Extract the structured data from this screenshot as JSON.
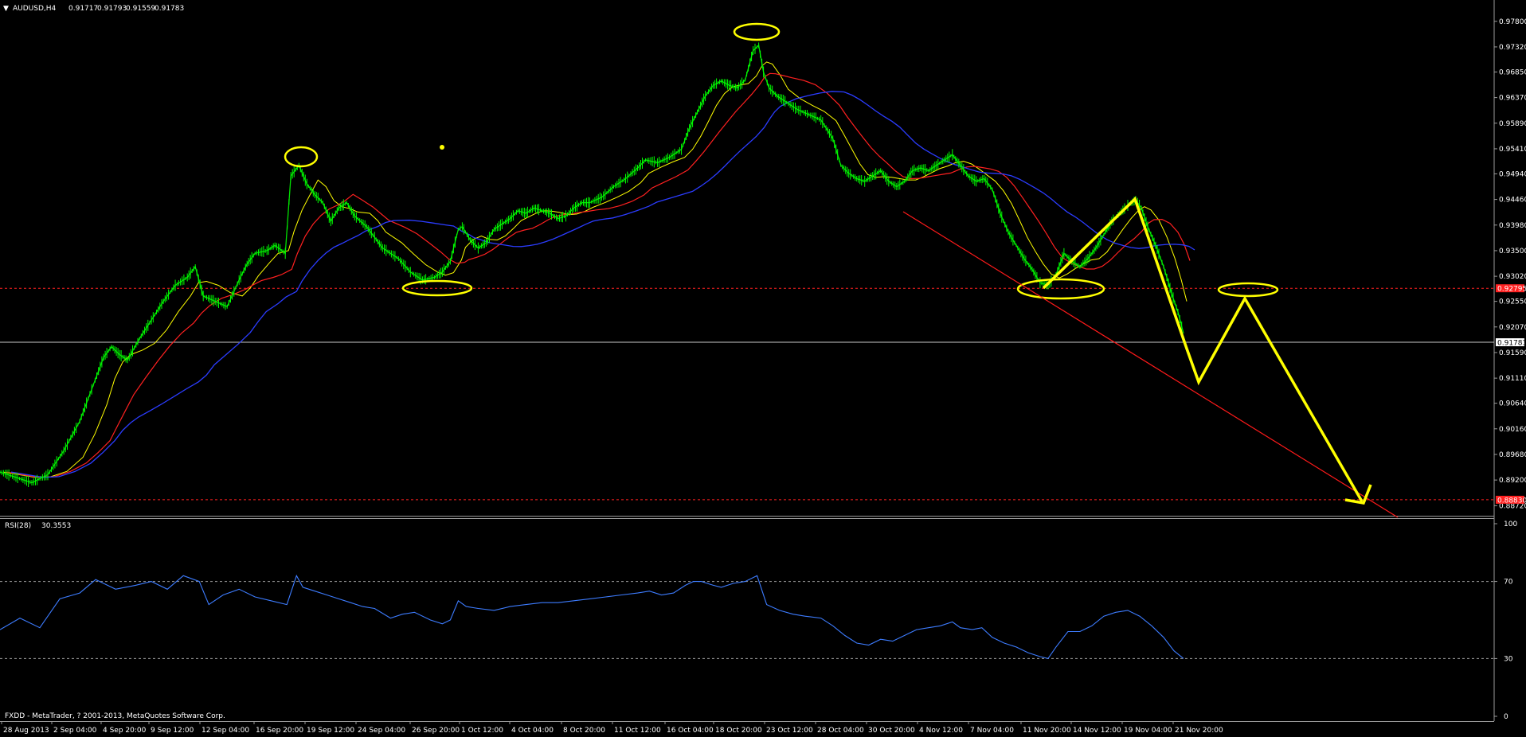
{
  "chart_data": [
    {
      "type": "line",
      "instrument_label": "AUDUSD,H4",
      "ohlc_readout": [
        "0.91717",
        "0.91793",
        "0.91559",
        "0.91783"
      ],
      "x_ticks": [
        "28 Aug 2013",
        "2 Sep 04:00",
        "4 Sep 20:00",
        "9 Sep 12:00",
        "12 Sep 04:00",
        "16 Sep 20:00",
        "19 Sep 12:00",
        "24 Sep 04:00",
        "26 Sep 20:00",
        "1 Oct 12:00",
        "4 Oct 04:00",
        "8 Oct 20:00",
        "11 Oct 12:00",
        "16 Oct 04:00",
        "18 Oct 20:00",
        "23 Oct 12:00",
        "28 Oct 04:00",
        "30 Oct 20:00",
        "4 Nov 12:00",
        "7 Nov 04:00",
        "11 Nov 20:00",
        "14 Nov 12:00",
        "19 Nov 04:00",
        "21 Nov 20:00"
      ],
      "y_ticks": [
        "0.97800",
        "0.97320",
        "0.96850",
        "0.96370",
        "0.95890",
        "0.95410",
        "0.94940",
        "0.94460",
        "0.93980",
        "0.93500",
        "0.93020",
        "0.92550",
        "0.92070",
        "0.91590",
        "0.91110",
        "0.90640",
        "0.90160",
        "0.89680",
        "0.89200",
        "0.88720"
      ],
      "ylim": [
        0.8862,
        0.9808
      ],
      "price_tags": [
        {
          "text": "0.92795",
          "value": 0.92795,
          "color": "#ff2020"
        },
        {
          "text": "0.91783",
          "value": 0.91783,
          "color": "#ffffff"
        },
        {
          "text": "0.88830",
          "value": 0.8883,
          "color": "#ff2020"
        }
      ],
      "series": [
        {
          "role": "price",
          "color": "#00ff00",
          "x": [
            0,
            6,
            11,
            14,
            20,
            25,
            28,
            30,
            33,
            35,
            38,
            40,
            43,
            46,
            49,
            52,
            54,
            57,
            61,
            65,
            68,
            73,
            78,
            81,
            84,
            86,
            88,
            90,
            93,
            95,
            98,
            101,
            103,
            104,
            106,
            109,
            110,
            111,
            113,
            114,
            116,
            117,
            118,
            119,
            120,
            122,
            123,
            124,
            126,
            128,
            131,
            133,
            135,
            137,
            139,
            141,
            143,
            144,
            147,
            149,
            153,
            156,
            158,
            160,
            162,
            164,
            165,
            167,
            170,
            175,
            179,
            183,
            187,
            189,
            191,
            193,
            195,
            198,
            201,
            203,
            205,
            208,
            210,
            213,
            215,
            218,
            219,
            221,
            223,
            226,
            227,
            228,
            229,
            231,
            232,
            232.5,
            233,
            236,
            240,
            243,
            246,
            248,
            250,
            252,
            255,
            257,
            260,
            263,
            266,
            268,
            271,
            273,
            275,
            277,
            279,
            281,
            283,
            285,
            287
          ],
          "y": [
            0.893,
            0.8922,
            0.8916,
            0.8912,
            0.8922,
            0.8935,
            0.8948,
            0.8965,
            0.8982,
            0.8997,
            0.9012,
            0.9025,
            0.9035,
            0.9048,
            0.9058,
            0.9068,
            0.9082,
            0.9096,
            0.9113,
            0.913,
            0.9146,
            0.9158,
            0.9168,
            0.9175,
            0.9166,
            0.9156,
            0.9161,
            0.9172,
            0.9188,
            0.9205,
            0.9218,
            0.923,
            0.9242,
            0.9254,
            0.9265,
            0.9277,
            0.9289,
            0.93,
            0.9312,
            0.9322,
            0.9303,
            0.9285,
            0.9275,
            0.927,
            0.9265,
            0.9259,
            0.9252,
            0.9247,
            0.9243,
            0.9258,
            0.929,
            0.932,
            0.9329,
            0.9321,
            0.9318,
            0.9327,
            0.9336,
            0.9343,
            0.9355,
            0.9359,
            0.937,
            0.944,
            0.9482,
            0.951,
            0.9521,
            0.9515,
            0.9497,
            0.9482,
            0.9468,
            0.9458,
            0.9451,
            0.9439,
            0.9425,
            0.9405,
            0.9415,
            0.9433,
            0.9442,
            0.9428,
            0.9418,
            0.9405,
            0.9392,
            0.938,
            0.9365,
            0.935,
            0.9347,
            0.9332,
            0.9318,
            0.9305,
            0.9295,
            0.9284,
            0.9287,
            0.9298,
            0.931,
            0.932,
            0.933,
            0.9337,
            0.9345,
            0.9353,
            0.9357,
            0.9368,
            0.9384,
            0.9398,
            0.9407,
            0.9415,
            0.942,
            0.943,
            0.9445,
            0.9458,
            0.9468,
            0.9479,
            0.9484,
            0.9487,
            0.9481,
            0.9472,
            0.9461,
            0.9449,
            0.9431,
            0.942,
            0.9412
          ]
        },
        {
          "role": "price-continued",
          "color": "#00ff00",
          "x": [
            287,
            290,
            293,
            296,
            300,
            302,
            304,
            306,
            308,
            310,
            313,
            316,
            319,
            322,
            324,
            326,
            328,
            330,
            332,
            334,
            336,
            338,
            340,
            343,
            345,
            347,
            349,
            351,
            352,
            353,
            354,
            356,
            358,
            360,
            362,
            364,
            366,
            368,
            370,
            372,
            373,
            375,
            377,
            379,
            381,
            383,
            385,
            386,
            388,
            390,
            391,
            392,
            393,
            394,
            396,
            398,
            400,
            402,
            404,
            406,
            408,
            410,
            412,
            414,
            416,
            418,
            420,
            422,
            425,
            428,
            431,
            434,
            437,
            440,
            443,
            446,
            449,
            452,
            455,
            458,
            461,
            464,
            467,
            470,
            473,
            476,
            479,
            482
          ],
          "y": [
            0.9412,
            0.942,
            0.943,
            0.9444,
            0.9468,
            0.949,
            0.9508,
            0.9523,
            0.9535,
            0.9547,
            0.9559,
            0.9569,
            0.9578,
            0.9591,
            0.9605,
            0.962,
            0.9634,
            0.9648,
            0.9662,
            0.9668,
            0.9674,
            0.9675,
            0.9669,
            0.9663,
            0.9657,
            0.9666,
            0.9679,
            0.9692,
            0.9704,
            0.9718,
            0.9735,
            0.97,
            0.9668,
            0.9652,
            0.9638,
            0.9626,
            0.9633,
            0.9641,
            0.9637,
            0.9625,
            0.9617,
            0.9622,
            0.9612,
            0.9601,
            0.9595,
            0.9602,
            0.9611,
            0.9596,
            0.9582,
            0.9563,
            0.9547,
            0.953,
            0.9518,
            0.9503,
            0.9495,
            0.9488,
            0.9483,
            0.9492,
            0.9503,
            0.9498,
            0.949,
            0.9482,
            0.9476,
            0.947,
            0.9466,
            0.948,
            0.9497,
            0.9508,
            0.9511,
            0.9505,
            0.9498,
            0.9503,
            0.9512,
            0.9519,
            0.9525,
            0.953,
            0.9532,
            0.9526,
            0.9517,
            0.9505,
            0.949,
            0.9478,
            0.946,
            0.9445,
            0.943,
            0.9415,
            0.94,
            0.9385
          ]
        }
      ]
    }
  ],
  "rsi": {
    "label": "RSI(28)",
    "value": "30.3553",
    "y_ticks": [
      "100",
      "70",
      "30",
      "0"
    ]
  },
  "footer": {
    "copyright": "FXDD - MetaTrader, ? 2001-2013, MetaQuotes Software Corp."
  }
}
